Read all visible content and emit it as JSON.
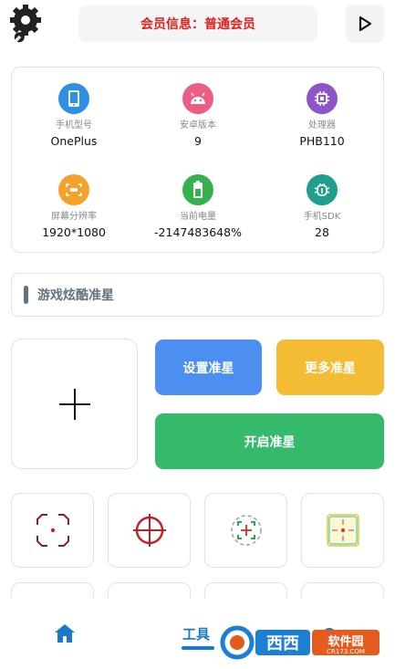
{
  "header": {
    "member_info": "会员信息：普通会员",
    "settings_icon": "gear-wrench-icon",
    "play_icon": "play-icon"
  },
  "device_info": [
    {
      "label": "手机型号",
      "value": "OnePlus",
      "icon": "phone-icon",
      "color": "#2e8fe6"
    },
    {
      "label": "安卓版本",
      "value": "9",
      "icon": "android-icon",
      "color": "#ec5e85"
    },
    {
      "label": "处理器",
      "value": "PHB110",
      "icon": "cpu-icon",
      "color": "#8c55c9"
    },
    {
      "label": "屏幕分辨率",
      "value": "1920*1080",
      "icon": "screen-icon",
      "color": "#f6a12a"
    },
    {
      "label": "当前电量",
      "value": "-2147483648%",
      "icon": "battery-icon",
      "color": "#35b24f"
    },
    {
      "label": "手机SDK",
      "value": "28",
      "icon": "sdk-icon",
      "color": "#1f9e8c"
    }
  ],
  "section": {
    "title": "游戏炫酷准星"
  },
  "actions": {
    "set_crosshair": "设置准星",
    "more_crosshair": "更多准星",
    "start_crosshair": "开启准星"
  },
  "colors": {
    "set": "#4c8ff0",
    "more": "#f4bb34",
    "start": "#35b96a",
    "accent": "#1a79c8",
    "member_text": "#e0201c"
  },
  "bottom_nav": {
    "tools_label": "工具",
    "home_icon": "home-icon"
  },
  "watermark": {
    "main": "西西",
    "sub": "软件园",
    "url": "CR173.COM"
  }
}
